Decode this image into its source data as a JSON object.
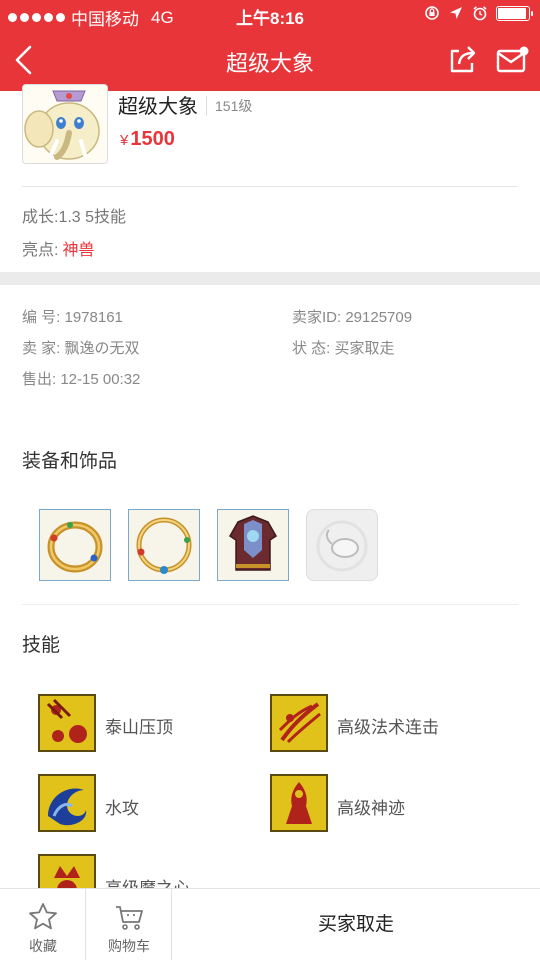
{
  "status_bar": {
    "carrier": "中国移动",
    "network": "4G",
    "time": "上午8:16"
  },
  "nav": {
    "title": "超级大象",
    "back_icon": "chevron-left-icon",
    "share_icon": "share-icon",
    "message_icon": "mail-icon"
  },
  "pet": {
    "name": "超级大象",
    "level": "151级",
    "price_symbol": "¥",
    "price": "1500",
    "growth": "成长:1.3 5技能",
    "highlight_label": "亮点:",
    "highlight_value": "神兽"
  },
  "details": {
    "id_label": "编   号: 1978161",
    "seller_id": "卖家ID: 29125709",
    "seller": "卖   家: 飘逸の无双",
    "status": "状   态: 买家取走",
    "sold": "售出: 12-15 00:32"
  },
  "equipment": {
    "title": "装备和饰品",
    "items": [
      "ring-gold",
      "ring-gold",
      "armor",
      "empty-slot"
    ]
  },
  "skills": {
    "title": "技能",
    "items": [
      {
        "name": "泰山压顶"
      },
      {
        "name": "高级法术连击"
      },
      {
        "name": "水攻"
      },
      {
        "name": "高级神迹"
      },
      {
        "name": "高级魔之心"
      }
    ]
  },
  "bottom_bar": {
    "favorite_label": "收藏",
    "cart_label": "购物车",
    "status_text": "买家取走"
  },
  "colors": {
    "accent": "#e8353a",
    "skill_bg": "#e0c21a"
  }
}
